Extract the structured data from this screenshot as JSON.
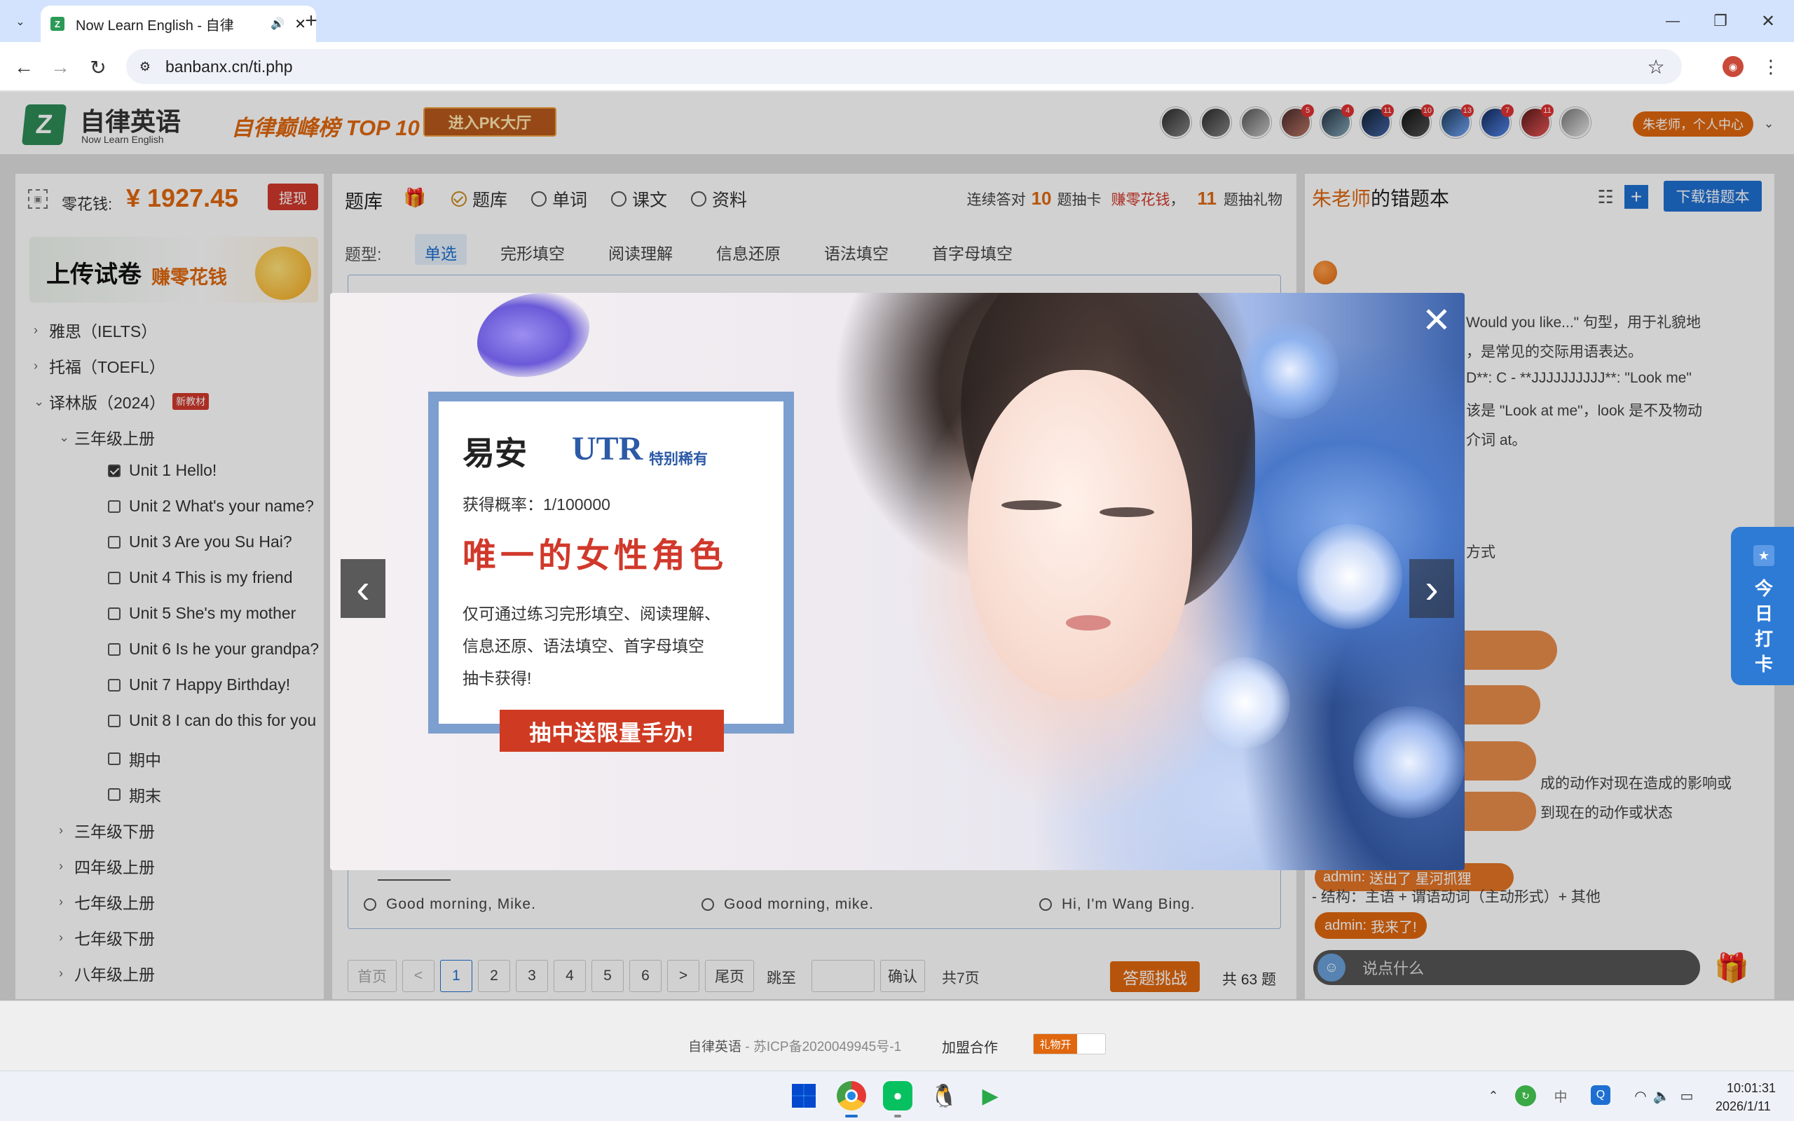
{
  "browser": {
    "tab_title": "Now Learn English - 自律",
    "url": "banbanx.cn/ti.php",
    "new_tab": "+",
    "window_minimize": "—",
    "window_restore": "❐",
    "window_close": "✕"
  },
  "header": {
    "logo_letter": "Z",
    "logo_cn": "自律英语",
    "logo_en": "Now Learn English",
    "slogan": "自律巅峰榜 TOP 10",
    "pk_button": "进入PK大厅",
    "user_menu": "朱老师，个人中心",
    "avatar_badges": [
      "",
      "",
      "",
      "5",
      "4",
      "11",
      "10",
      "13",
      "7",
      "11",
      ""
    ]
  },
  "left": {
    "wallet_label": "零花钱:",
    "wallet_amount": "¥ 1927.45",
    "withdraw_button": "提现",
    "upload_banner": "上传试卷",
    "upload_banner_accent": "赚零花钱",
    "tree": {
      "ielts": "雅思（IELTS）",
      "toefl": "托福（TOEFL）",
      "yilin": "译林版（2024）",
      "yilin_badge": "新教材",
      "grade3a": "三年级上册",
      "units": [
        "Unit 1 Hello!",
        "Unit 2 What's your name?",
        "Unit 3 Are you Su Hai?",
        "Unit 4 This is my friend",
        "Unit 5 She's my mother",
        "Unit 6 Is he your grandpa?",
        "Unit 7 Happy Birthday!",
        "Unit 8 I can do this for you",
        "期中",
        "期末"
      ],
      "more_grades": [
        "三年级下册",
        "四年级上册",
        "七年级上册",
        "七年级下册",
        "八年级上册"
      ]
    }
  },
  "middle": {
    "bank_title": "题库",
    "radios": [
      "题库",
      "单词",
      "课文",
      "资料"
    ],
    "streak_prefix": "连续答对",
    "streak_n1": "10",
    "streak_mid": "题抽卡",
    "streak_earn": "赚零花钱",
    "streak_sep": "，",
    "streak_n2": "11",
    "streak_suffix": "题抽礼物",
    "type_label": "题型:",
    "types": [
      "单选",
      "完形填空",
      "阅读理解",
      "信息还原",
      "语法填空",
      "首字母填空"
    ],
    "options": [
      "Good morning, Mike.",
      "Good morning, mike.",
      "Hi, I'm Wang Bing."
    ],
    "pagination": {
      "first": "首页",
      "prev": "<",
      "pages": [
        "1",
        "2",
        "3",
        "4",
        "5",
        "6"
      ],
      "next": ">",
      "last": "尾页",
      "jump": "跳至",
      "confirm": "确认",
      "total_pages": "共7页",
      "challenge": "答题挑战",
      "total_questions": "共 63 题"
    }
  },
  "right": {
    "owner": "朱老师",
    "title_suffix": "的错题本",
    "download_button": "下载错题本",
    "explain_lines": [
      "Would you like...\" 句型，用于礼貌地",
      "，是常见的交际用语表达。",
      "D**: C - **JJJJJJJJJJ**: \"Look me\"",
      "该是 \"Look at me\"，look 是不及物动",
      "介词 at。"
    ],
    "fragment_method": "方式",
    "fragment_perfect1": "成的动作对现在造成的影响或",
    "fragment_perfect2": "到现在的动作或状态",
    "structure_line": "- 结构：主语 + 谓语动词（主动形式）+ 其他",
    "chat_user": "admin:",
    "chat_msg1": "送出了 星河抓狸",
    "chat_msg2": "我来了!",
    "chat_placeholder": "说点什么"
  },
  "modal": {
    "name": "易安",
    "rarity_tag": "UTR",
    "rarity_text": "特别稀有",
    "probability": "获得概率：1/100000",
    "headline": "唯一的女性角色",
    "desc1": "仅可通过练习完形填空、阅读理解、",
    "desc2": "信息还原、语法填空、首字母填空",
    "desc3": "抽卡获得!",
    "cta": "抽中送限量手办!"
  },
  "checkin": {
    "label": "今日打卡"
  },
  "footer": {
    "site": "自律英语",
    "icp": " - 苏ICP备2020049945号-1",
    "join": "加盟合作",
    "gift_toggle": "礼物开"
  },
  "taskbar": {
    "time": "10:01:31",
    "date": "2026/1/11",
    "ime": "中"
  },
  "colors": {
    "brand_orange": "#e0670e",
    "brand_blue": "#1f6fd1",
    "red": "#d0392b",
    "green": "#2f8a3c"
  }
}
